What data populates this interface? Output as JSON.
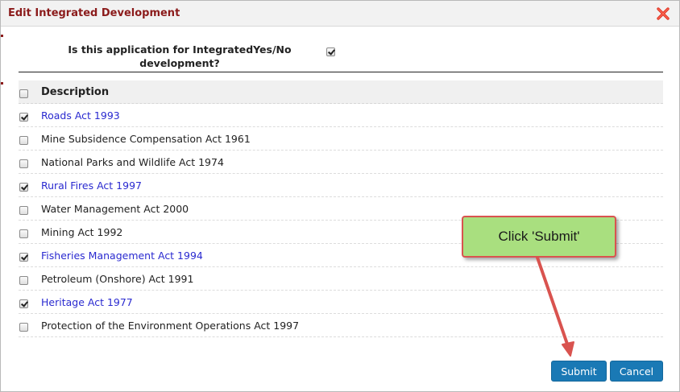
{
  "dialog": {
    "title": "Edit Integrated Development",
    "close_icon": "close-x-icon"
  },
  "question": {
    "text": "Is this application for IntegratedYes/No development?",
    "checked": true
  },
  "table": {
    "header": "Description",
    "header_checked": false,
    "rows": [
      {
        "label": "Roads Act 1993",
        "checked": true
      },
      {
        "label": "Mine Subsidence Compensation Act 1961",
        "checked": false
      },
      {
        "label": "National Parks and Wildlife Act 1974",
        "checked": false
      },
      {
        "label": "Rural Fires Act 1997",
        "checked": true
      },
      {
        "label": "Water Management Act 2000",
        "checked": false
      },
      {
        "label": "Mining Act 1992",
        "checked": false
      },
      {
        "label": "Fisheries Management Act 1994",
        "checked": true
      },
      {
        "label": "Petroleum (Onshore) Act 1991",
        "checked": false
      },
      {
        "label": "Heritage Act 1977",
        "checked": true
      },
      {
        "label": "Protection of the Environment Operations Act 1997",
        "checked": false
      }
    ]
  },
  "buttons": {
    "submit": "Submit",
    "cancel": "Cancel"
  },
  "callout": {
    "text": "Click 'Submit'"
  },
  "colors": {
    "title": "#8b1b1b",
    "link": "#2a2ad0",
    "button": "#1a79b5",
    "callout_fill": "#a9df7f",
    "callout_border": "#d9534f"
  }
}
